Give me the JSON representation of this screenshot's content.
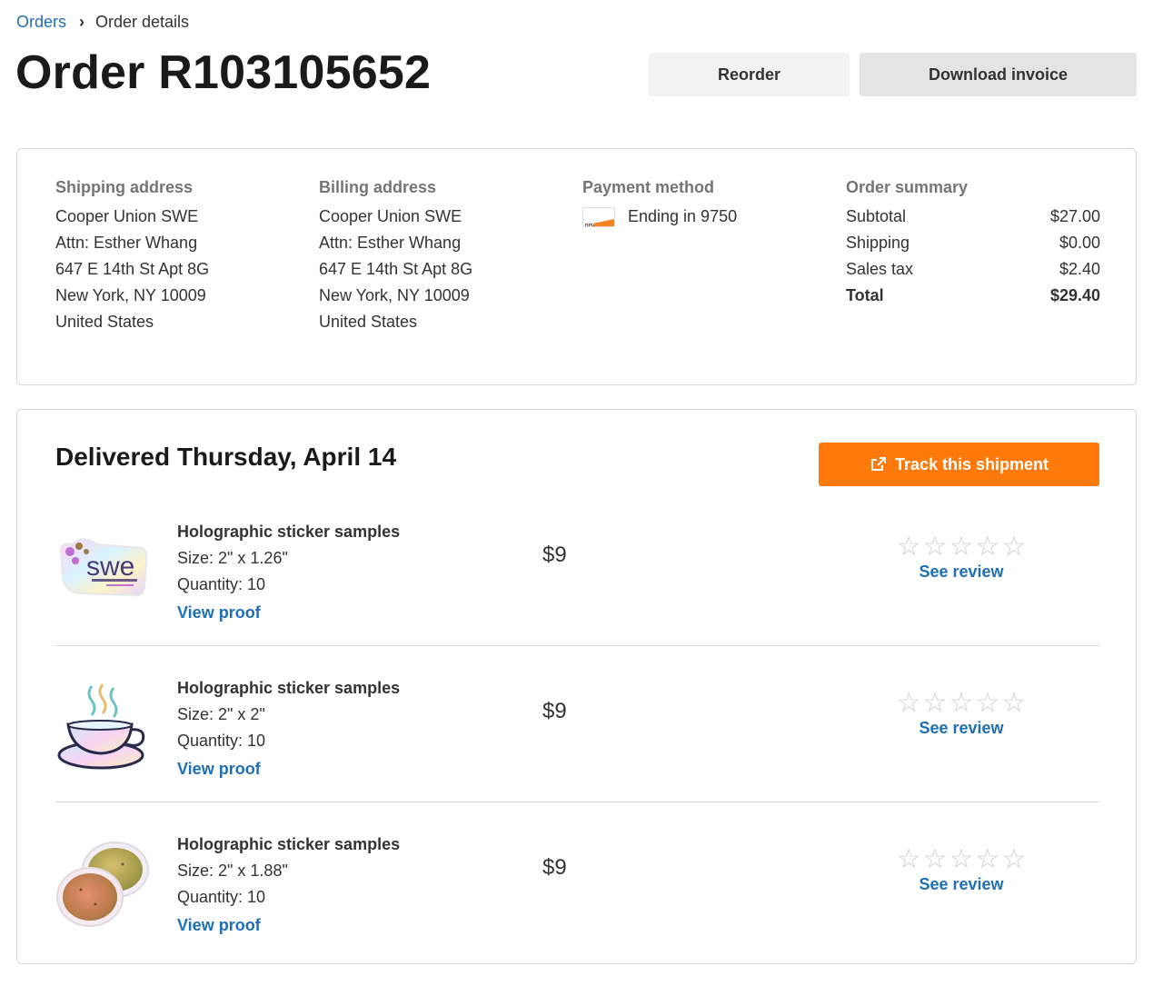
{
  "breadcrumb": {
    "orders": "Orders",
    "separator": "›",
    "current": "Order details"
  },
  "header": {
    "title": "Order R103105652",
    "reorder": "Reorder",
    "download_invoice": "Download invoice"
  },
  "shipping": {
    "heading": "Shipping address",
    "lines": [
      "Cooper Union SWE",
      "Attn: Esther Whang",
      "647 E 14th St Apt 8G",
      "New York, NY 10009",
      "United States"
    ]
  },
  "billing": {
    "heading": "Billing address",
    "lines": [
      "Cooper Union SWE",
      "Attn: Esther Whang",
      "647 E 14th St Apt 8G",
      "New York, NY 10009",
      "United States"
    ]
  },
  "payment": {
    "heading": "Payment method",
    "card_brand_icon": "discover-card-icon",
    "card_logo_text": "DISCOVER",
    "text": "Ending in 9750"
  },
  "summary": {
    "heading": "Order summary",
    "rows": [
      {
        "label": "Subtotal",
        "value": "$27.00"
      },
      {
        "label": "Shipping",
        "value": "$0.00"
      },
      {
        "label": "Sales tax",
        "value": "$2.40"
      },
      {
        "label": "Total",
        "value": "$29.40"
      }
    ]
  },
  "shipment": {
    "title": "Delivered Thursday, April 14",
    "track_label": "Track this shipment",
    "track_icon": "external-link-icon",
    "items": [
      {
        "thumb": "swe-sticker",
        "thumb_text": "swe",
        "name": "Holographic sticker samples",
        "size": "Size: 2\" x 1.26\"",
        "quantity": "Quantity: 10",
        "proof": "View proof",
        "price": "$9",
        "stars": 0,
        "review": "See review"
      },
      {
        "thumb": "teacup-sticker",
        "name": "Holographic sticker samples",
        "size": "Size: 2\" x 2\"",
        "quantity": "Quantity: 10",
        "proof": "View proof",
        "price": "$9",
        "stars": 0,
        "review": "See review"
      },
      {
        "thumb": "potato-sticker",
        "name": "Holographic sticker samples",
        "size": "Size: 2\" x 1.88\"",
        "quantity": "Quantity: 10",
        "proof": "View proof",
        "price": "$9",
        "stars": 0,
        "review": "See review"
      }
    ]
  },
  "colors": {
    "link": "#1f6fb5",
    "accent": "#ff7a0a",
    "border": "#d6d6d6",
    "star_empty": "#cfcfcf"
  }
}
